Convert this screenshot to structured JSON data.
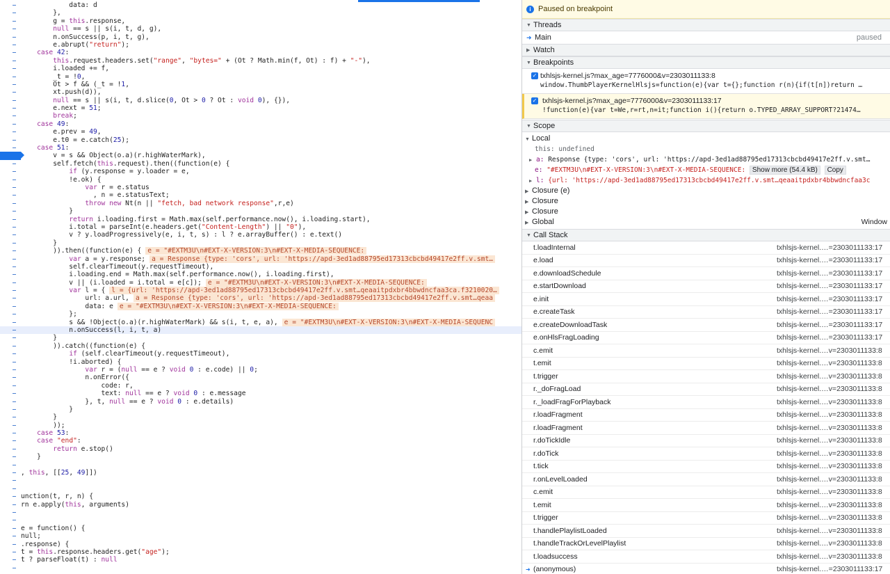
{
  "editor": {
    "lines": [
      [
        {
          "t": "            data: d"
        }
      ],
      [
        {
          "t": "        },"
        }
      ],
      [
        {
          "t": "        g = "
        },
        {
          "c": "kw",
          "t": "this"
        },
        {
          "t": ".response,"
        }
      ],
      [
        {
          "t": "        "
        },
        {
          "c": "kw",
          "t": "null"
        },
        {
          "t": " == s || s(i, t, d, g),"
        }
      ],
      [
        {
          "t": "        n.onSuccess(p, i, t, g),"
        }
      ],
      [
        {
          "t": "        e.abrupt("
        },
        {
          "c": "str",
          "t": "\"return\""
        },
        {
          "t": ");"
        }
      ],
      [
        {
          "t": "    "
        },
        {
          "c": "kw",
          "t": "case"
        },
        {
          "t": " "
        },
        {
          "c": "num",
          "t": "42"
        },
        {
          "t": ":"
        }
      ],
      [
        {
          "t": "        "
        },
        {
          "c": "kw",
          "t": "this"
        },
        {
          "t": ".request.headers.set("
        },
        {
          "c": "str",
          "t": "\"range\""
        },
        {
          "t": ", "
        },
        {
          "c": "str",
          "t": "\"bytes=\""
        },
        {
          "t": " + (Ot ? Math.min(f, Ot) : f) + "
        },
        {
          "c": "str",
          "t": "\"-\""
        },
        {
          "t": "),"
        }
      ],
      [
        {
          "t": "        i.loaded += f,"
        }
      ],
      [
        {
          "t": "        _t = !"
        },
        {
          "c": "num",
          "t": "0"
        },
        {
          "t": ","
        }
      ],
      [
        {
          "t": "        Ot > f && (_t = !"
        },
        {
          "c": "num",
          "t": "1"
        },
        {
          "t": ","
        }
      ],
      [
        {
          "t": "        xt.push(d)),"
        }
      ],
      [
        {
          "t": "        "
        },
        {
          "c": "kw",
          "t": "null"
        },
        {
          "t": " == s || s(i, t, d.slice("
        },
        {
          "c": "num",
          "t": "0"
        },
        {
          "t": ", Ot > "
        },
        {
          "c": "num",
          "t": "0"
        },
        {
          "t": " ? Ot : "
        },
        {
          "c": "kw",
          "t": "void"
        },
        {
          "t": " "
        },
        {
          "c": "num",
          "t": "0"
        },
        {
          "t": "), {}),"
        }
      ],
      [
        {
          "t": "        e.next = "
        },
        {
          "c": "num",
          "t": "51"
        },
        {
          "t": ";"
        }
      ],
      [
        {
          "t": "        "
        },
        {
          "c": "kw",
          "t": "break"
        },
        {
          "t": ";"
        }
      ],
      [
        {
          "t": "    "
        },
        {
          "c": "kw",
          "t": "case"
        },
        {
          "t": " "
        },
        {
          "c": "num",
          "t": "49"
        },
        {
          "t": ":"
        }
      ],
      [
        {
          "t": "        e.prev = "
        },
        {
          "c": "num",
          "t": "49"
        },
        {
          "t": ","
        }
      ],
      [
        {
          "t": "        e.t0 = e.catch("
        },
        {
          "c": "num",
          "t": "25"
        },
        {
          "t": ");"
        }
      ],
      [
        {
          "t": "    "
        },
        {
          "c": "kw",
          "t": "case"
        },
        {
          "t": " "
        },
        {
          "c": "num",
          "t": "51"
        },
        {
          "t": ":"
        }
      ],
      [
        {
          "t": "        v = s && Object(o.a)(r.highWaterMark),"
        }
      ],
      [
        {
          "t": "        self.fetch("
        },
        {
          "c": "kw",
          "t": "this"
        },
        {
          "t": ".request).then((function(e) {"
        }
      ],
      [
        {
          "t": "            "
        },
        {
          "c": "kw",
          "t": "if"
        },
        {
          "t": " (y.response = y.loader = e,"
        }
      ],
      [
        {
          "t": "            !e.ok) {"
        }
      ],
      [
        {
          "t": "                "
        },
        {
          "c": "kw",
          "t": "var"
        },
        {
          "t": " r = e.status"
        }
      ],
      [
        {
          "t": "                  , n = e.statusText;"
        }
      ],
      [
        {
          "t": "                "
        },
        {
          "c": "kw",
          "t": "throw new"
        },
        {
          "t": " Nt(n || "
        },
        {
          "c": "str",
          "t": "\"fetch, bad network response\""
        },
        {
          "t": ",r,e)"
        }
      ],
      [
        {
          "t": "            }"
        }
      ],
      [
        {
          "t": "            "
        },
        {
          "c": "kw",
          "t": "return"
        },
        {
          "t": " i.loading.first = Math.max(self.performance.now(), i.loading.start),"
        }
      ],
      [
        {
          "t": "            i.total = parseInt(e.headers.get("
        },
        {
          "c": "str",
          "t": "\"Content-Length\""
        },
        {
          "t": ") || "
        },
        {
          "c": "str",
          "t": "\"0\""
        },
        {
          "t": "),"
        }
      ],
      [
        {
          "t": "            v ? y.loadProgressively(e, i, t, s) : l ? e.arrayBuffer() : e.text()"
        }
      ],
      [
        {
          "t": "        }"
        }
      ],
      [
        {
          "t": "        )).then((function(e) {"
        },
        {
          "c": "ann",
          "t": "e = \"#EXTM3U\\n#EXT-X-VERSION:3\\n#EXT-X-MEDIA-SEQUENCE:"
        }
      ],
      [
        {
          "t": "            "
        },
        {
          "c": "kw",
          "t": "var"
        },
        {
          "t": " a = y.response;"
        },
        {
          "c": "ann",
          "t": "a = Response {type: 'cors', url: 'https://apd-3ed1ad88795ed17313cbcbd49417e2ff.v.smt…"
        }
      ],
      [
        {
          "t": "            self.clearTimeout(y.requestTimeout),"
        }
      ],
      [
        {
          "t": "            i.loading.end = Math.max(self.performance.now(), i.loading.first),"
        }
      ],
      [
        {
          "t": "            v || (i.loaded = i.total = e[c]);"
        },
        {
          "c": "ann",
          "t": "e = \"#EXTM3U\\n#EXT-X-VERSION:3\\n#EXT-X-MEDIA-SEQUENCE:"
        }
      ],
      [
        {
          "t": "            "
        },
        {
          "c": "kw",
          "t": "var"
        },
        {
          "t": " l = {"
        },
        {
          "c": "ann",
          "t": "l = {url: 'https://apd-3ed1ad88795ed17313cbcbd49417e2ff.v.smt…qeaaitpdxbr4bbwdncfaa3ca.f3210020…"
        }
      ],
      [
        {
          "t": "                url: a.url,"
        },
        {
          "c": "ann",
          "t": "a = Response {type: 'cors', url: 'https://apd-3ed1ad88795ed17313cbcbd49417e2ff.v.smt…qeaa"
        }
      ],
      [
        {
          "t": "                data: e"
        },
        {
          "c": "ann",
          "t": "e = \"#EXTM3U\\n#EXT-X-VERSION:3\\n#EXT-X-MEDIA-SEQUENCE:"
        }
      ],
      [
        {
          "t": "            };"
        }
      ],
      [
        {
          "t": "            s && !Object(o.a)(r.highWaterMark) && s(i, t, e, a),"
        },
        {
          "c": "ann",
          "t": "e = \"#EXTM3U\\n#EXT-X-VERSION:3\\n#EXT-X-MEDIA-SEQUENC"
        }
      ],
      [
        {
          "t": "            n.onSuccess(l, i, t, a)"
        }
      ],
      [
        {
          "t": "        }"
        }
      ],
      [
        {
          "t": "        )).catch((function(e) {"
        }
      ],
      [
        {
          "t": "            "
        },
        {
          "c": "kw",
          "t": "if"
        },
        {
          "t": " (self.clearTimeout(y.requestTimeout),"
        }
      ],
      [
        {
          "t": "            !i.aborted) {"
        }
      ],
      [
        {
          "t": "                "
        },
        {
          "c": "kw",
          "t": "var"
        },
        {
          "t": " r = ("
        },
        {
          "c": "kw",
          "t": "null"
        },
        {
          "t": " == e ? "
        },
        {
          "c": "kw",
          "t": "void"
        },
        {
          "t": " "
        },
        {
          "c": "num",
          "t": "0"
        },
        {
          "t": " : e.code) || "
        },
        {
          "c": "num",
          "t": "0"
        },
        {
          "t": ";"
        }
      ],
      [
        {
          "t": "                n.onError({"
        }
      ],
      [
        {
          "t": "                    code: r,"
        }
      ],
      [
        {
          "t": "                    text: "
        },
        {
          "c": "kw",
          "t": "null"
        },
        {
          "t": " == e ? "
        },
        {
          "c": "kw",
          "t": "void"
        },
        {
          "t": " "
        },
        {
          "c": "num",
          "t": "0"
        },
        {
          "t": " : e.message"
        }
      ],
      [
        {
          "t": "                }, t, "
        },
        {
          "c": "kw",
          "t": "null"
        },
        {
          "t": " == e ? "
        },
        {
          "c": "kw",
          "t": "void"
        },
        {
          "t": " "
        },
        {
          "c": "num",
          "t": "0"
        },
        {
          "t": " : e.details)"
        }
      ],
      [
        {
          "t": "            }"
        }
      ],
      [
        {
          "t": "        }"
        }
      ],
      [
        {
          "t": "        ));"
        }
      ],
      [
        {
          "t": "    "
        },
        {
          "c": "kw",
          "t": "case"
        },
        {
          "t": " "
        },
        {
          "c": "num",
          "t": "53"
        },
        {
          "t": ":"
        }
      ],
      [
        {
          "t": "    "
        },
        {
          "c": "kw",
          "t": "case"
        },
        {
          "t": " "
        },
        {
          "c": "str",
          "t": "\"end\""
        },
        {
          "t": ":"
        }
      ],
      [
        {
          "t": "        "
        },
        {
          "c": "kw",
          "t": "return"
        },
        {
          "t": " e.stop()"
        }
      ],
      [
        {
          "t": "    }"
        }
      ],
      [
        {
          "t": ""
        }
      ],
      [
        {
          "t": ", "
        },
        {
          "c": "kw",
          "t": "this"
        },
        {
          "t": ", [["
        },
        {
          "c": "num",
          "t": "25"
        },
        {
          "t": ", "
        },
        {
          "c": "num",
          "t": "49"
        },
        {
          "t": "]])"
        }
      ],
      [
        {
          "t": ""
        }
      ],
      [
        {
          "t": ""
        }
      ],
      [
        {
          "t": "unction(t, r, n) {"
        }
      ],
      [
        {
          "t": "rn e.apply("
        },
        {
          "c": "kw",
          "t": "this"
        },
        {
          "t": ", arguments)"
        }
      ],
      [
        {
          "t": ""
        }
      ],
      [
        {
          "t": ""
        }
      ],
      [
        {
          "t": "e = function() {"
        }
      ],
      [
        {
          "t": "null;"
        }
      ],
      [
        {
          "t": ".response) {"
        }
      ],
      [
        {
          "t": "t = "
        },
        {
          "c": "kw",
          "t": "this"
        },
        {
          "t": ".response.headers.get("
        },
        {
          "c": "str",
          "t": "\"age\""
        },
        {
          "t": ");"
        }
      ],
      [
        {
          "t": "t ? parseFloat(t) : "
        },
        {
          "c": "kw",
          "t": "null"
        }
      ],
      [
        {
          "t": ""
        }
      ],
      [
        {
          "t": ""
        }
      ]
    ],
    "breakpoint_line": 19,
    "paused_line": 41
  },
  "sidebar": {
    "banner": "Paused on breakpoint",
    "threads": {
      "title": "Threads",
      "items": [
        {
          "name": "Main",
          "state": "paused"
        }
      ]
    },
    "watch_title": "Watch",
    "breakpoints": {
      "title": "Breakpoints",
      "items": [
        {
          "file": "txhlsjs-kernel.js?max_age=7776000&v=2303011133:8",
          "code": "window.ThumbPlayerKernelHlsjs=function(e){var t={};function r(n){if(t[n])return …",
          "active": false
        },
        {
          "file": "txhlsjs-kernel.js?max_age=7776000&v=2303011133:17",
          "code": "!function(e){var t=We,r=rt,n=it;function i(){return o.TYPED_ARRAY_SUPPORT?21474…",
          "active": true
        }
      ]
    },
    "scope": {
      "title": "Scope",
      "local_title": "Local",
      "this_label": "this:",
      "this_value": "undefined",
      "a_key": "a:",
      "a_value": "Response {type: 'cors', url: 'https://apd-3ed1ad88795ed17313cbcbd49417e2ff.v.smt…",
      "e_key": "e:",
      "e_value": "\"#EXTM3U\\n#EXT-X-VERSION:3\\n#EXT-X-MEDIA-SEQUENCE:",
      "show_more": "Show more (54.4 kB)",
      "copy": "Copy",
      "l_key": "l:",
      "l_value": "{url: 'https://apd-3ed1ad88795ed17313cbcbd49417e2ff.v.smt…qeaaitpdxbr4bbwdncfaa3c",
      "closure_e": "Closure (e)",
      "closure_1": "Closure",
      "closure_2": "Closure",
      "global": "Global",
      "global_value": "Window"
    },
    "callstack": {
      "title": "Call Stack",
      "frames": [
        {
          "fn": "t.loadInternal",
          "loc": "txhlsjs-kernel.…=2303011133:17"
        },
        {
          "fn": "e.load",
          "loc": "txhlsjs-kernel.…=2303011133:17"
        },
        {
          "fn": "e.downloadSchedule",
          "loc": "txhlsjs-kernel.…=2303011133:17"
        },
        {
          "fn": "e.startDownload",
          "loc": "txhlsjs-kernel.…=2303011133:17"
        },
        {
          "fn": "e.init",
          "loc": "txhlsjs-kernel.…=2303011133:17"
        },
        {
          "fn": "e.createTask",
          "loc": "txhlsjs-kernel.…=2303011133:17"
        },
        {
          "fn": "e.createDownloadTask",
          "loc": "txhlsjs-kernel.…=2303011133:17"
        },
        {
          "fn": "e.onHlsFragLoading",
          "loc": "txhlsjs-kernel.…=2303011133:17"
        },
        {
          "fn": "c.emit",
          "loc": "txhlsjs-kernel.…v=2303011133:8"
        },
        {
          "fn": "t.emit",
          "loc": "txhlsjs-kernel.…v=2303011133:8"
        },
        {
          "fn": "t.trigger",
          "loc": "txhlsjs-kernel.…v=2303011133:8"
        },
        {
          "fn": "r._doFragLoad",
          "loc": "txhlsjs-kernel.…v=2303011133:8"
        },
        {
          "fn": "r._loadFragForPlayback",
          "loc": "txhlsjs-kernel.…v=2303011133:8"
        },
        {
          "fn": "r.loadFragment",
          "loc": "txhlsjs-kernel.…v=2303011133:8"
        },
        {
          "fn": "r.loadFragment",
          "loc": "txhlsjs-kernel.…v=2303011133:8"
        },
        {
          "fn": "r.doTickIdle",
          "loc": "txhlsjs-kernel.…v=2303011133:8"
        },
        {
          "fn": "r.doTick",
          "loc": "txhlsjs-kernel.…v=2303011133:8"
        },
        {
          "fn": "t.tick",
          "loc": "txhlsjs-kernel.…v=2303011133:8"
        },
        {
          "fn": "r.onLevelLoaded",
          "loc": "txhlsjs-kernel.…v=2303011133:8"
        },
        {
          "fn": "c.emit",
          "loc": "txhlsjs-kernel.…v=2303011133:8"
        },
        {
          "fn": "t.emit",
          "loc": "txhlsjs-kernel.…v=2303011133:8"
        },
        {
          "fn": "t.trigger",
          "loc": "txhlsjs-kernel.…v=2303011133:8"
        },
        {
          "fn": "t.handlePlaylistLoaded",
          "loc": "txhlsjs-kernel.…v=2303011133:8"
        },
        {
          "fn": "t.handleTrackOrLevelPlaylist",
          "loc": "txhlsjs-kernel.…v=2303011133:8"
        },
        {
          "fn": "t.loadsuccess",
          "loc": "txhlsjs-kernel.…v=2303011133:8"
        },
        {
          "fn": "(anonymous)",
          "loc": "txhlsjs-kernel.…=2303011133:17"
        }
      ]
    }
  }
}
